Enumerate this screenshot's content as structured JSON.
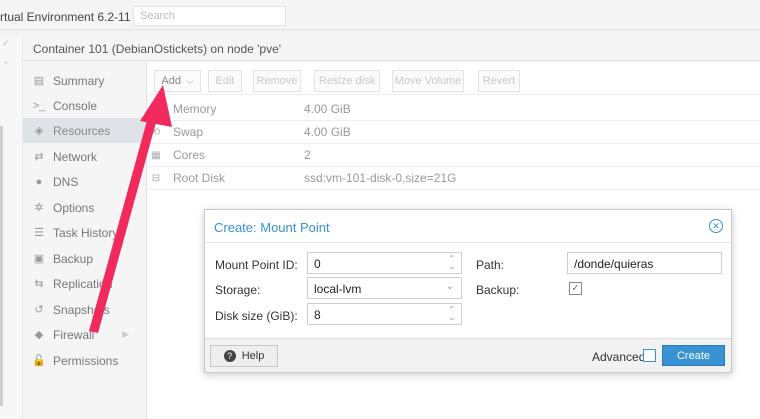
{
  "header": {
    "title": "rtual Environment 6.2-11",
    "search_placeholder": "Search"
  },
  "panel": {
    "title": "Container 101 (DebianOstickets) on node 'pve'"
  },
  "sidebar": {
    "items": [
      {
        "label": "Summary",
        "icon": "summary-icon",
        "glyph": "▤"
      },
      {
        "label": "Console",
        "icon": "console-icon",
        "glyph": ">_"
      },
      {
        "label": "Resources",
        "icon": "resources-icon",
        "glyph": "◈"
      },
      {
        "label": "Network",
        "icon": "network-icon",
        "glyph": "⇄"
      },
      {
        "label": "DNS",
        "icon": "dns-icon",
        "glyph": "●"
      },
      {
        "label": "Options",
        "icon": "options-icon",
        "glyph": "✲"
      },
      {
        "label": "Task History",
        "icon": "task-history-icon",
        "glyph": "☰"
      },
      {
        "label": "Backup",
        "icon": "backup-icon",
        "glyph": "▣"
      },
      {
        "label": "Replication",
        "icon": "replication-icon",
        "glyph": "⇆"
      },
      {
        "label": "Snapshots",
        "icon": "snapshots-icon",
        "glyph": "↺"
      },
      {
        "label": "Firewall",
        "icon": "firewall-icon",
        "glyph": "◆"
      },
      {
        "label": "Permissions",
        "icon": "permissions-icon",
        "glyph": "🔓"
      }
    ],
    "active": "Resources"
  },
  "toolbar": {
    "add_label": "Add",
    "add_chevron": "⌵",
    "edit_label": "Edit",
    "remove_label": "Remove",
    "resize_label": "Resize disk",
    "move_label": "Move Volume",
    "revert_label": "Revert"
  },
  "resources": [
    {
      "key": "Memory",
      "value": "4.00 GiB",
      "icon": "memory-icon",
      "glyph": "▥"
    },
    {
      "key": "Swap",
      "value": "4.00 GiB",
      "icon": "swap-icon",
      "glyph": "⟲"
    },
    {
      "key": "Cores",
      "value": "2",
      "icon": "cpu-icon",
      "glyph": "▦"
    },
    {
      "key": "Root Disk",
      "value": "ssd:vm-101-disk-0,size=21G",
      "icon": "disk-icon",
      "glyph": "⊟"
    }
  ],
  "dialog": {
    "title": "Create: Mount Point",
    "close_glyph": "✕",
    "mount_point_id_label": "Mount Point ID:",
    "mount_point_id_value": "0",
    "path_label": "Path:",
    "path_value": "/donde/quieras",
    "storage_label": "Storage:",
    "storage_value": "local-lvm",
    "backup_label": "Backup:",
    "backup_checked": "✓",
    "disk_size_label": "Disk size (GiB):",
    "disk_size_value": "8",
    "help_label": "Help",
    "help_glyph": "?",
    "advanced_label": "Advanced",
    "create_label": "Create"
  },
  "annotation": {
    "arrow_color": "#f02a5c"
  }
}
